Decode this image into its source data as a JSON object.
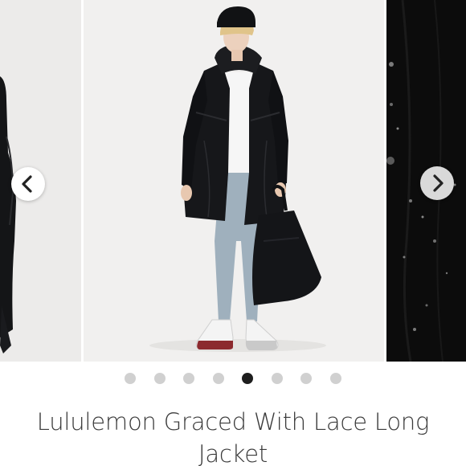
{
  "listing": {
    "title": "Lululemon Graced With Lace Long Jacket"
  },
  "carousel": {
    "slide_count": 8,
    "active_index": 4,
    "prev_icon": "chevron-left-icon",
    "next_icon": "chevron-right-icon"
  },
  "colors": {
    "active_dot": "#1e1e1e",
    "inactive_dot": "#d0d0d0",
    "jacket": "#16171a",
    "leggings": "#9fb0bd"
  }
}
